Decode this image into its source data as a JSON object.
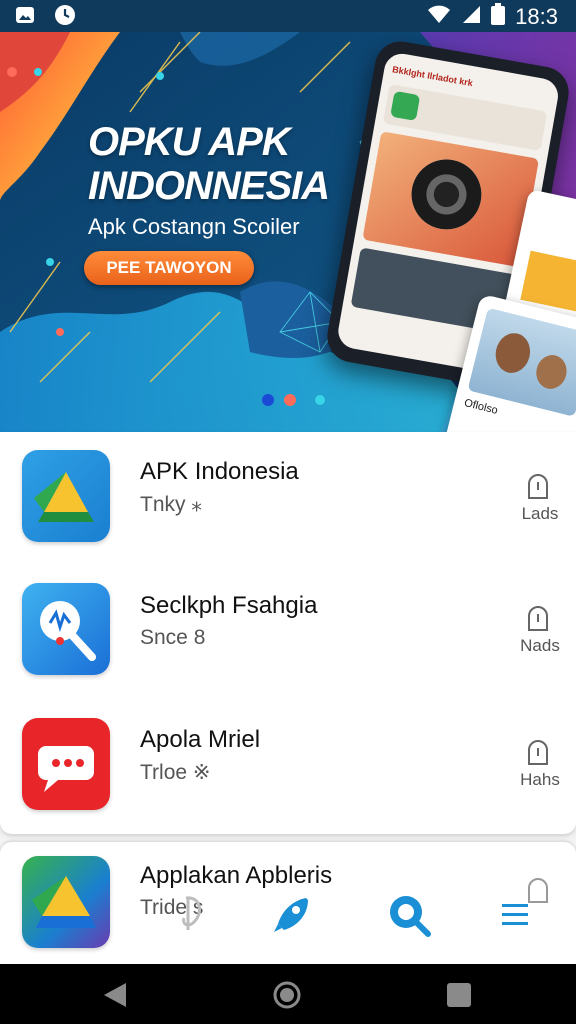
{
  "status_bar": {
    "time": "18:3",
    "icons": [
      "image-icon",
      "clock-icon",
      "wifi-icon",
      "signal-icon",
      "battery-icon"
    ]
  },
  "hero": {
    "title_line1": "OPKU APK",
    "title_line2": "INDONNESIA",
    "subtitle": "Apk Costangn Scoiler",
    "cta_label": "PEE TAWOYON",
    "phone_header": "Bkklght Ilrladot krk",
    "card_caption": "Oflolso"
  },
  "apps": [
    {
      "name": "APK Indonesia",
      "sub": "Tnky ⁎",
      "action": "Lads",
      "icon": "drive-triangle-icon"
    },
    {
      "name": "Seclkph Fsahgia",
      "sub": "Snce 8",
      "action": "Nads",
      "icon": "microphone-icon"
    },
    {
      "name": "Apola Mriel",
      "sub": "Trloe ※",
      "action": "Hahs",
      "icon": "chat-bubble-icon"
    },
    {
      "name": "Applakan Apbleris",
      "sub": "Tride s",
      "action": "",
      "icon": "drive-triangle-icon"
    }
  ],
  "bottom_nav": {
    "icons": [
      "music-note-icon",
      "rocket-icon",
      "search-icon",
      "menu-icon"
    ]
  },
  "system_nav": {
    "icons": [
      "back-icon",
      "home-icon",
      "recents-icon"
    ]
  },
  "colors": {
    "status_bar": "#0f3a5c",
    "accent_blue": "#1a8fd6",
    "cta_orange": "#f07a2a",
    "nav_bar": "#000000"
  }
}
